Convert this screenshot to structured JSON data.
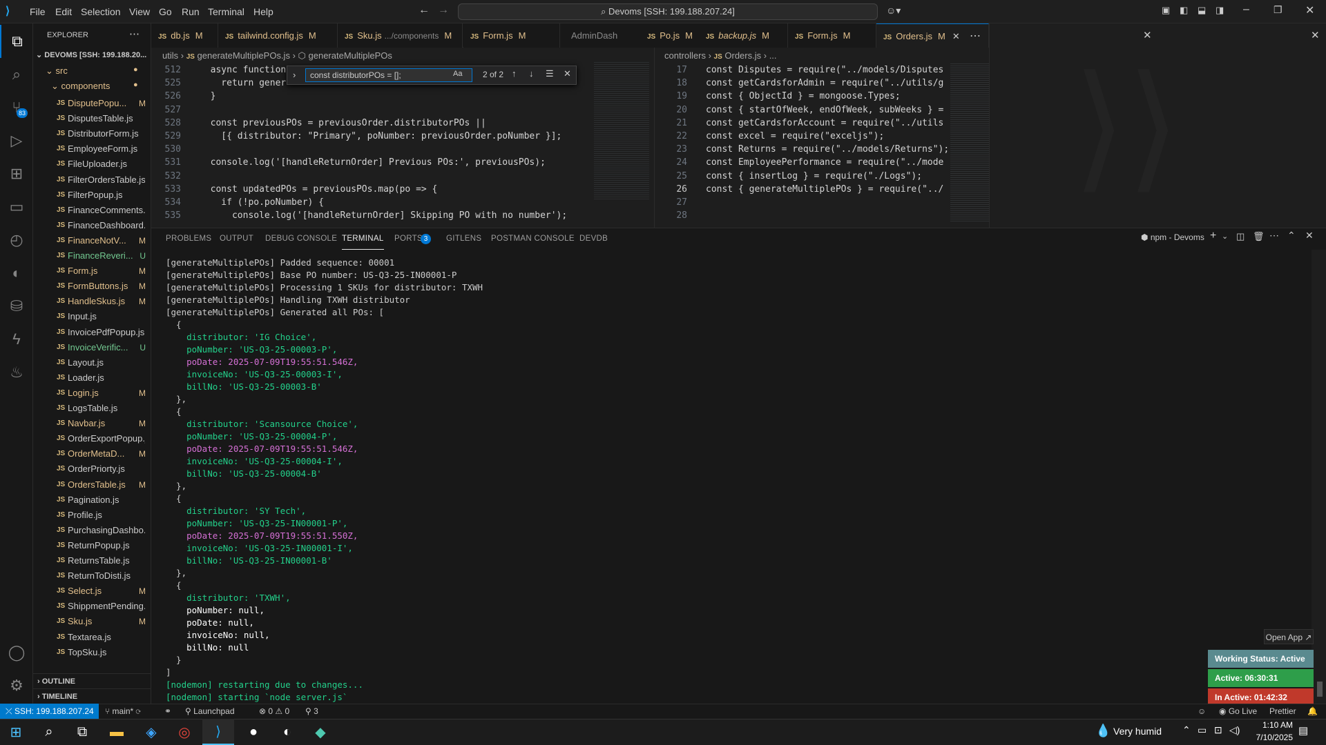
{
  "titlebar": {
    "menus": [
      "File",
      "Edit",
      "Selection",
      "View",
      "Go",
      "Run",
      "Terminal",
      "Help"
    ],
    "search": "Devoms [SSH: 199.188.207.24]"
  },
  "explorer": {
    "title": "EXPLORER",
    "root": "DEVOMS [SSH: 199.188.20...",
    "src": "src",
    "components": "components",
    "files": [
      {
        "name": "DisputePopu...",
        "status": "M",
        "color": "#e2c08d"
      },
      {
        "name": "DisputesTable.js",
        "status": "",
        "color": "#ccc"
      },
      {
        "name": "DistributorForm.js",
        "status": "",
        "color": "#ccc"
      },
      {
        "name": "EmployeeForm.js",
        "status": "",
        "color": "#ccc"
      },
      {
        "name": "FileUploader.js",
        "status": "",
        "color": "#ccc"
      },
      {
        "name": "FilterOrdersTable.js",
        "status": "",
        "color": "#ccc"
      },
      {
        "name": "FilterPopup.js",
        "status": "",
        "color": "#ccc"
      },
      {
        "name": "FinanceComments.js",
        "status": "",
        "color": "#ccc"
      },
      {
        "name": "FinanceDashboard.js",
        "status": "",
        "color": "#ccc"
      },
      {
        "name": "FinanceNotV...",
        "status": "M",
        "color": "#e2c08d"
      },
      {
        "name": "FinanceReveri...",
        "status": "U",
        "color": "#73c991"
      },
      {
        "name": "Form.js",
        "status": "M",
        "color": "#e2c08d"
      },
      {
        "name": "FormButtons.js",
        "status": "M",
        "color": "#e2c08d"
      },
      {
        "name": "HandleSkus.js",
        "status": "M",
        "color": "#e2c08d"
      },
      {
        "name": "Input.js",
        "status": "",
        "color": "#ccc"
      },
      {
        "name": "InvoicePdfPopup.js",
        "status": "",
        "color": "#ccc"
      },
      {
        "name": "InvoiceVerific...",
        "status": "U",
        "color": "#73c991"
      },
      {
        "name": "Layout.js",
        "status": "",
        "color": "#ccc"
      },
      {
        "name": "Loader.js",
        "status": "",
        "color": "#ccc"
      },
      {
        "name": "Login.js",
        "status": "M",
        "color": "#e2c08d"
      },
      {
        "name": "LogsTable.js",
        "status": "",
        "color": "#ccc"
      },
      {
        "name": "Navbar.js",
        "status": "M",
        "color": "#e2c08d"
      },
      {
        "name": "OrderExportPopup.js",
        "status": "",
        "color": "#ccc"
      },
      {
        "name": "OrderMetaD...",
        "status": "M",
        "color": "#e2c08d"
      },
      {
        "name": "OrderPriorty.js",
        "status": "",
        "color": "#ccc"
      },
      {
        "name": "OrdersTable.js",
        "status": "M",
        "color": "#e2c08d"
      },
      {
        "name": "Pagination.js",
        "status": "",
        "color": "#ccc"
      },
      {
        "name": "Profile.js",
        "status": "",
        "color": "#ccc"
      },
      {
        "name": "PurchasingDashbo...",
        "status": "",
        "color": "#ccc"
      },
      {
        "name": "ReturnPopup.js",
        "status": "",
        "color": "#ccc"
      },
      {
        "name": "ReturnsTable.js",
        "status": "",
        "color": "#ccc"
      },
      {
        "name": "ReturnToDisti.js",
        "status": "",
        "color": "#ccc"
      },
      {
        "name": "Select.js",
        "status": "M",
        "color": "#e2c08d"
      },
      {
        "name": "ShippmentPending...",
        "status": "",
        "color": "#ccc"
      },
      {
        "name": "Sku.js",
        "status": "M",
        "color": "#e2c08d"
      },
      {
        "name": "Textarea.js",
        "status": "",
        "color": "#ccc"
      },
      {
        "name": "TopSku.js",
        "status": "",
        "color": "#ccc"
      }
    ],
    "outline": "OUTLINE",
    "timeline": "TIMELINE"
  },
  "tabs": [
    {
      "name": "db.js",
      "status": "M"
    },
    {
      "name": "tailwind.config.js",
      "status": "M"
    },
    {
      "name": "Sku.js",
      "desc": ".../components",
      "status": "M"
    },
    {
      "name": "Form.js",
      "status": "M"
    },
    {
      "name": "AdminDash",
      "status": ""
    },
    {
      "name": "Po.js",
      "status": "M"
    },
    {
      "name": "backup.js",
      "status": "M"
    },
    {
      "name": "Form.js",
      "status": "M"
    },
    {
      "name": "Orders.js",
      "status": "M"
    }
  ],
  "left_editor": {
    "crumb1": "utils",
    "crumb2": "generateMultiplePOs.js",
    "crumb3": "generateMultiplePOs",
    "find_text": "const distributorPOs = [];",
    "find_count": "2 of 2",
    "lines": [
      {
        "n": "512",
        "t": "  async function h"
      },
      {
        "n": "525",
        "t": "    return gener"
      },
      {
        "n": "526",
        "t": "  }"
      },
      {
        "n": "527",
        "t": ""
      },
      {
        "n": "528",
        "t": "  const previousPOs = previousOrder.distributorPOs ||"
      },
      {
        "n": "529",
        "t": "    [{ distributor: \"Primary\", poNumber: previousOrder.poNumber }];"
      },
      {
        "n": "530",
        "t": ""
      },
      {
        "n": "531",
        "t": "  console.log('[handleReturnOrder] Previous POs:', previousPOs);"
      },
      {
        "n": "532",
        "t": ""
      },
      {
        "n": "533",
        "t": "  const updatedPOs = previousPOs.map(po => {"
      },
      {
        "n": "534",
        "t": "    if (!po.poNumber) {"
      },
      {
        "n": "535",
        "t": "      console.log('[handleReturnOrder] Skipping PO with no number');"
      }
    ]
  },
  "right_editor": {
    "crumb1": "controllers",
    "crumb2": "Orders.js",
    "crumb3": "...",
    "lines": [
      {
        "n": "17",
        "t": "const Disputes = require(\"../models/Disputes"
      },
      {
        "n": "18",
        "t": "const getCardsforAdmin = require(\"../utils/g"
      },
      {
        "n": "19",
        "t": "const { ObjectId } = mongoose.Types;"
      },
      {
        "n": "20",
        "t": "const { startOfWeek, endOfWeek, subWeeks } ="
      },
      {
        "n": "21",
        "t": "const getCardsforAccount = require(\"../utils"
      },
      {
        "n": "22",
        "t": "const excel = require(\"exceljs\");"
      },
      {
        "n": "23",
        "t": "const Returns = require(\"../models/Returns\");"
      },
      {
        "n": "24",
        "t": "const EmployeePerformance = require(\"../mode"
      },
      {
        "n": "25",
        "t": "const { insertLog } = require(\"./Logs\");"
      },
      {
        "n": "26",
        "t": "const { generateMultiplePOs } = require(\"../"
      },
      {
        "n": "27",
        "t": ""
      },
      {
        "n": "28",
        "t": ""
      }
    ]
  },
  "panel": {
    "tabs": [
      "PROBLEMS",
      "OUTPUT",
      "DEBUG CONSOLE",
      "TERMINAL",
      "PORTS",
      "GITLENS",
      "POSTMAN CONSOLE",
      "DEVDB"
    ],
    "ports_badge": "3",
    "terminal_name": "npm - Devoms"
  },
  "terminal": [
    {
      "t": "[generateMultiplePOs] Padded sequence: 00001",
      "c": ""
    },
    {
      "t": "[generateMultiplePOs] Base PO number: US-Q3-25-IN00001-P",
      "c": ""
    },
    {
      "t": "[generateMultiplePOs] Processing 1 SKUs for distributor: TXWH",
      "c": ""
    },
    {
      "t": "[generateMultiplePOs] Handling TXWH distributor",
      "c": ""
    },
    {
      "t": "[generateMultiplePOs] Generated all POs: [",
      "c": ""
    },
    {
      "t": "  {",
      "c": ""
    },
    {
      "t": "    distributor: 'IG Choice',",
      "c": "s"
    },
    {
      "t": "    poNumber: 'US-Q3-25-00003-P',",
      "c": "s"
    },
    {
      "t": "    poDate: 2025-07-09T19:55:51.546Z,",
      "c": "d"
    },
    {
      "t": "    invoiceNo: 'US-Q3-25-00003-I',",
      "c": "s"
    },
    {
      "t": "    billNo: 'US-Q3-25-00003-B'",
      "c": "s"
    },
    {
      "t": "  },",
      "c": ""
    },
    {
      "t": "  {",
      "c": ""
    },
    {
      "t": "    distributor: 'Scansource Choice',",
      "c": "s"
    },
    {
      "t": "    poNumber: 'US-Q3-25-00004-P',",
      "c": "s"
    },
    {
      "t": "    poDate: 2025-07-09T19:55:51.546Z,",
      "c": "d"
    },
    {
      "t": "    invoiceNo: 'US-Q3-25-00004-I',",
      "c": "s"
    },
    {
      "t": "    billNo: 'US-Q3-25-00004-B'",
      "c": "s"
    },
    {
      "t": "  },",
      "c": ""
    },
    {
      "t": "  {",
      "c": ""
    },
    {
      "t": "    distributor: 'SY Tech',",
      "c": "s"
    },
    {
      "t": "    poNumber: 'US-Q3-25-IN00001-P',",
      "c": "s"
    },
    {
      "t": "    poDate: 2025-07-09T19:55:51.550Z,",
      "c": "d"
    },
    {
      "t": "    invoiceNo: 'US-Q3-25-IN00001-I',",
      "c": "s"
    },
    {
      "t": "    billNo: 'US-Q3-25-IN00001-B'",
      "c": "s"
    },
    {
      "t": "  },",
      "c": ""
    },
    {
      "t": "  {",
      "c": ""
    },
    {
      "t": "    distributor: 'TXWH',",
      "c": "s"
    },
    {
      "t": "    poNumber: null,",
      "c": "n"
    },
    {
      "t": "    poDate: null,",
      "c": "n"
    },
    {
      "t": "    invoiceNo: null,",
      "c": "n"
    },
    {
      "t": "    billNo: null",
      "c": "n"
    },
    {
      "t": "  }",
      "c": ""
    },
    {
      "t": "]",
      "c": ""
    },
    {
      "t": "[nodemon] restarting due to changes...",
      "c": "g"
    },
    {
      "t": "[nodemon] starting `node server.js`",
      "c": "g"
    }
  ],
  "overlay": {
    "open_app": "Open App ↗",
    "working": "Working Status: Active",
    "active": "Active: 06:30:31",
    "inactive": "In Active: 01:42:32"
  },
  "status": {
    "remote": "SSH: 199.188.207.24",
    "branch": "main*",
    "launchpad": "Launchpad",
    "errors": "0",
    "warnings": "0",
    "ports": "3",
    "golive": "Go Live",
    "prettier": "Prettier"
  },
  "taskbar": {
    "weather": "Very humid",
    "time": "1:10 AM",
    "date": "7/10/2025"
  },
  "colors": {
    "accent": "#0078d4",
    "remote": "#007acc"
  }
}
